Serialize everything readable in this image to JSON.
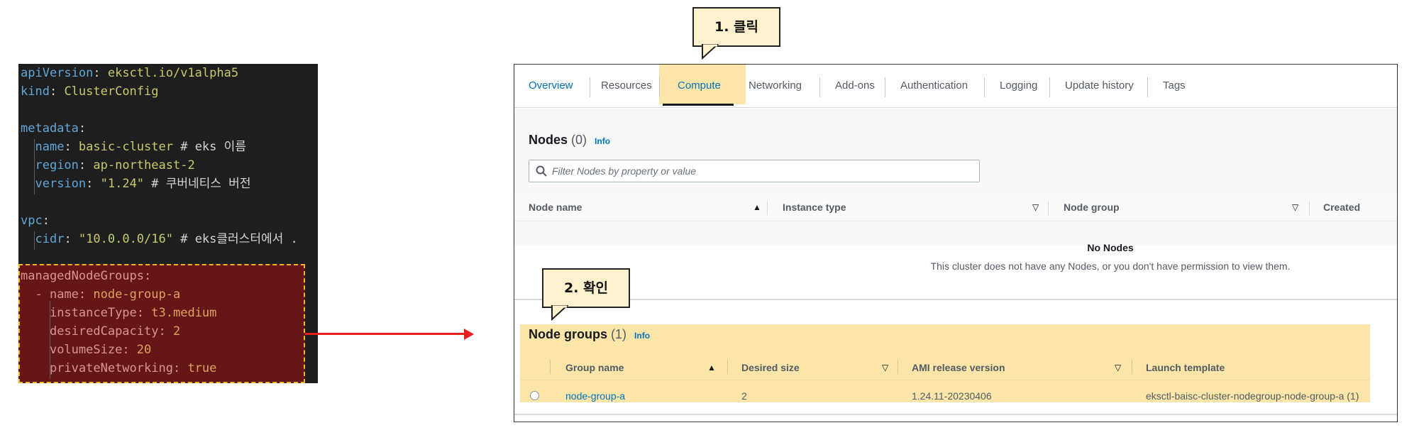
{
  "code": {
    "line1": {
      "key": "apiVersion",
      "colon": ": ",
      "value": "eksctl.io/v1alpha5"
    },
    "line2": {
      "key": "kind",
      "colon": ": ",
      "value": "ClusterConfig"
    },
    "line3": {
      "key": "metadata",
      "colon": ":"
    },
    "line4": {
      "key": "name",
      "colon": ": ",
      "value": "basic-cluster",
      "comment": " # eks 이름"
    },
    "line5": {
      "key": "region",
      "colon": ": ",
      "value": "ap-northeast-2"
    },
    "line6": {
      "key": "version",
      "colon": ": ",
      "value": "\"1.24\"",
      "comment": " # 쿠버네티스 버전"
    },
    "line7": {
      "key": "vpc",
      "colon": ":"
    },
    "line8": {
      "key": "cidr",
      "colon": ": ",
      "value": "\"10.0.0.0/16\"",
      "comment": " # eks클러스터에서 ."
    },
    "line9": {
      "key": "managedNodeGroups",
      "colon": ":"
    },
    "line10": {
      "dash": "- ",
      "key": "name",
      "colon": ": ",
      "value": "node-group-a"
    },
    "line11": {
      "key": "instanceType",
      "colon": ": ",
      "value": "t3.medium"
    },
    "line12": {
      "key": "desiredCapacity",
      "colon": ": ",
      "value": "2"
    },
    "line13": {
      "key": "volumeSize",
      "colon": ": ",
      "value": "20"
    },
    "line14": {
      "key": "privateNetworking",
      "colon": ": ",
      "value": "true"
    }
  },
  "callouts": {
    "step1": "1. 클릭",
    "step2": "2. 확인"
  },
  "tabs": [
    "Overview",
    "Resources",
    "Compute",
    "Networking",
    "Add-ons",
    "Authentication",
    "Logging",
    "Update history",
    "Tags"
  ],
  "nodes": {
    "title": "Nodes",
    "count": "(0)",
    "info": "Info",
    "filter_placeholder": "Filter Nodes by property or value",
    "columns": [
      "Node name",
      "Instance type",
      "Node group",
      "Created"
    ],
    "empty_title": "No Nodes",
    "empty_desc": "This cluster does not have any Nodes, or you don't have permission to view them."
  },
  "node_groups": {
    "title": "Node groups",
    "count": "(1)",
    "info": "Info",
    "columns": [
      "Group name",
      "Desired size",
      "AMI release version",
      "Launch template"
    ],
    "rows": [
      {
        "group_name": "node-group-a",
        "desired_size": "2",
        "ami_release_version": "1.24.11-20230406",
        "launch_template": "eksctl-baisc-cluster-nodegroup-node-group-a (1)"
      }
    ]
  },
  "colors": {
    "highlight": "#fbe5a8",
    "arrow": "#e8201d",
    "link": "#0073bb",
    "code_bg": "#1e1e1e",
    "code_highlight_bg": "#661616"
  },
  "icons": [
    "search-icon",
    "sort-ascending-icon",
    "sort-descending-icon",
    "arrow-right-icon",
    "radio-button-icon"
  ]
}
